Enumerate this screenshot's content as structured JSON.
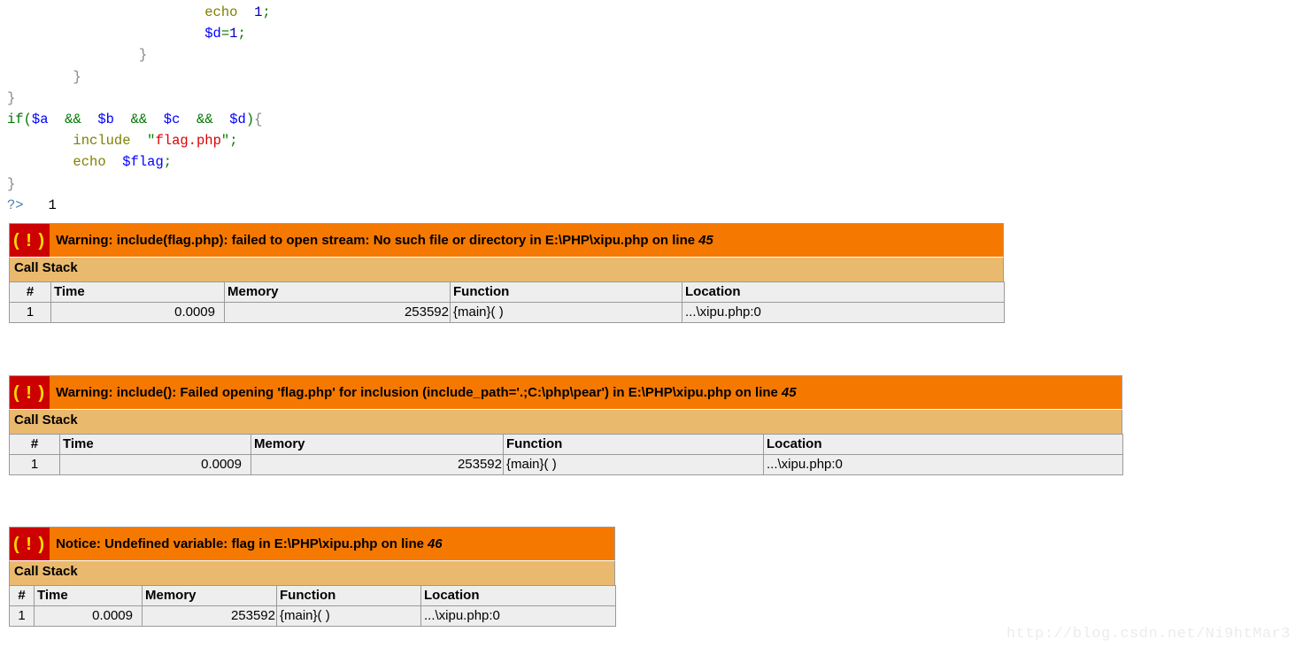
{
  "code": {
    "language": "php",
    "lines": [
      [
        {
          "t": "                        ",
          "c": "plain"
        },
        {
          "t": "echo",
          "c": "kw"
        },
        {
          "t": "  ",
          "c": "plain"
        },
        {
          "t": "1",
          "c": "num"
        },
        {
          "t": ";",
          "c": "punct"
        }
      ],
      [
        {
          "t": "                        ",
          "c": "plain"
        },
        {
          "t": "$d",
          "c": "var"
        },
        {
          "t": "=",
          "c": "punct"
        },
        {
          "t": "1",
          "c": "num"
        },
        {
          "t": ";",
          "c": "punct"
        }
      ],
      [
        {
          "t": "                ",
          "c": "plain"
        },
        {
          "t": "}",
          "c": "brace"
        }
      ],
      [
        {
          "t": "        ",
          "c": "plain"
        },
        {
          "t": "}",
          "c": "brace"
        }
      ],
      [
        {
          "t": "}",
          "c": "brace"
        }
      ],
      [
        {
          "t": "if",
          "c": "punct"
        },
        {
          "t": "(",
          "c": "punct"
        },
        {
          "t": "$a",
          "c": "var"
        },
        {
          "t": "  ",
          "c": "plain"
        },
        {
          "t": "&&",
          "c": "punct"
        },
        {
          "t": "  ",
          "c": "plain"
        },
        {
          "t": "$b",
          "c": "var"
        },
        {
          "t": "  ",
          "c": "plain"
        },
        {
          "t": "&&",
          "c": "punct"
        },
        {
          "t": "  ",
          "c": "plain"
        },
        {
          "t": "$c",
          "c": "var"
        },
        {
          "t": "  ",
          "c": "plain"
        },
        {
          "t": "&&",
          "c": "punct"
        },
        {
          "t": "  ",
          "c": "plain"
        },
        {
          "t": "$d",
          "c": "var"
        },
        {
          "t": ")",
          "c": "punct"
        },
        {
          "t": "{",
          "c": "brace"
        }
      ],
      [
        {
          "t": "        ",
          "c": "plain"
        },
        {
          "t": "include",
          "c": "kw"
        },
        {
          "t": "  ",
          "c": "plain"
        },
        {
          "t": "\"",
          "c": "quote"
        },
        {
          "t": "flag.php",
          "c": "str"
        },
        {
          "t": "\"",
          "c": "quote"
        },
        {
          "t": ";",
          "c": "punct"
        }
      ],
      [
        {
          "t": "        ",
          "c": "plain"
        },
        {
          "t": "echo",
          "c": "kw"
        },
        {
          "t": "  ",
          "c": "plain"
        },
        {
          "t": "$flag",
          "c": "var"
        },
        {
          "t": ";",
          "c": "punct"
        }
      ],
      [
        {
          "t": "}",
          "c": "brace"
        }
      ],
      [
        {
          "t": "?>",
          "c": "tag"
        },
        {
          "t": "   ",
          "c": "plain"
        },
        {
          "t": "1",
          "c": "plain"
        }
      ]
    ]
  },
  "colors": {
    "title_bar": "#f57900",
    "icon_bg": "#cc0000",
    "icon_fg": "#ffdd00",
    "callstack_bar": "#e9b96e",
    "table_bg": "#eeeeee",
    "border": "#9a9a9a",
    "watermark": "#ececec"
  },
  "errors": [
    {
      "icon": "warning-exclamation-icon",
      "icon_glyph": "( ! )",
      "message": "Warning: include(flag.php): failed to open stream: No such file or directory in E:\\PHP\\xipu.php on line",
      "line_number": "45",
      "callstack_label": "Call Stack",
      "columns": [
        "#",
        "Time",
        "Memory",
        "Function",
        "Location"
      ],
      "rows": [
        {
          "num": "1",
          "time": "0.0009",
          "memory": "253592",
          "function": "{main}( )",
          "location": "...\\xipu.php:0"
        }
      ]
    },
    {
      "icon": "warning-exclamation-icon",
      "icon_glyph": "( ! )",
      "message": "Warning: include(): Failed opening 'flag.php' for inclusion (include_path='.;C:\\php\\pear') in E:\\PHP\\xipu.php on line",
      "line_number": "45",
      "callstack_label": "Call Stack",
      "columns": [
        "#",
        "Time",
        "Memory",
        "Function",
        "Location"
      ],
      "rows": [
        {
          "num": "1",
          "time": "0.0009",
          "memory": "253592",
          "function": "{main}( )",
          "location": "...\\xipu.php:0"
        }
      ]
    },
    {
      "icon": "notice-exclamation-icon",
      "icon_glyph": "( ! )",
      "message": "Notice: Undefined variable: flag in E:\\PHP\\xipu.php on line",
      "line_number": "46",
      "callstack_label": "Call Stack",
      "columns": [
        "#",
        "Time",
        "Memory",
        "Function",
        "Location"
      ],
      "rows": [
        {
          "num": "1",
          "time": "0.0009",
          "memory": "253592",
          "function": "{main}( )",
          "location": "...\\xipu.php:0"
        }
      ]
    }
  ],
  "watermark": "http://blog.csdn.net/Ni9htMar3"
}
